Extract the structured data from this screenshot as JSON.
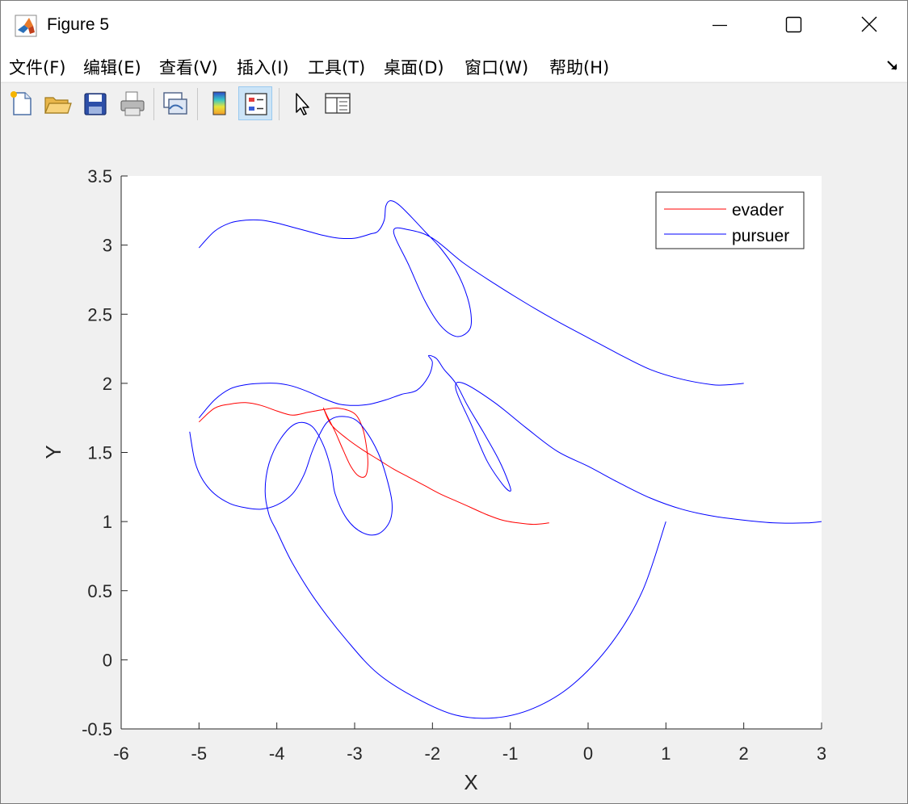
{
  "window": {
    "title": "Figure 5",
    "controls": {
      "minimize": "minimize",
      "maximize": "maximize",
      "close": "close"
    }
  },
  "menu": [
    {
      "label": "文件(F)"
    },
    {
      "label": "编辑(E)"
    },
    {
      "label": "查看(V)"
    },
    {
      "label": "插入(I)"
    },
    {
      "label": "工具(T)"
    },
    {
      "label": "桌面(D)"
    },
    {
      "label": "窗口(W)"
    },
    {
      "label": "帮助(H)"
    }
  ],
  "toolbar": [
    {
      "icon": "new-figure-icon"
    },
    {
      "icon": "open-file-icon"
    },
    {
      "icon": "save-icon"
    },
    {
      "icon": "print-icon"
    },
    {
      "icon": "link-plot-icon"
    },
    {
      "icon": "colorbar-icon"
    },
    {
      "icon": "legend-icon",
      "active": true
    },
    {
      "icon": "edit-plot-pointer-icon"
    },
    {
      "icon": "property-inspector-icon"
    }
  ],
  "chart_data": {
    "type": "line",
    "xlabel": "X",
    "ylabel": "Y",
    "xlim": [
      -6,
      3
    ],
    "ylim": [
      -0.5,
      3.5
    ],
    "xticks": [
      -6,
      -5,
      -4,
      -3,
      -2,
      -1,
      0,
      1,
      2,
      3
    ],
    "yticks": [
      -0.5,
      0,
      0.5,
      1,
      1.5,
      2,
      2.5,
      3,
      3.5
    ],
    "xtick_labels": [
      "-6",
      "-5",
      "-4",
      "-3",
      "-2",
      "-1",
      "0",
      "1",
      "2",
      "3"
    ],
    "ytick_labels": [
      "-0.5",
      "0",
      "0.5",
      "1",
      "1.5",
      "2",
      "2.5",
      "3",
      "3.5"
    ],
    "grid": false,
    "legend": {
      "position": "top-right",
      "entries": [
        "evader",
        "pursuer"
      ]
    },
    "colors": {
      "evader": "#ff0000",
      "pursuer": "#0000ff"
    },
    "series": [
      {
        "name": "evader",
        "color": "#ff0000",
        "x": [
          -5.0,
          -4.8,
          -4.6,
          -4.4,
          -4.2,
          -4.0,
          -3.8,
          -3.6,
          -3.4,
          -3.2,
          -3.0,
          -2.9,
          -2.85,
          -2.83,
          -2.86,
          -2.95,
          -3.05,
          -3.15,
          -3.25,
          -3.35,
          -3.4,
          -3.3,
          -3.1,
          -2.9,
          -2.7,
          -2.5,
          -2.3,
          -2.1,
          -1.9,
          -1.7,
          -1.5,
          -1.3,
          -1.1,
          -0.9,
          -0.7,
          -0.5
        ],
        "y": [
          1.72,
          1.82,
          1.85,
          1.86,
          1.84,
          1.8,
          1.77,
          1.79,
          1.81,
          1.82,
          1.78,
          1.68,
          1.55,
          1.42,
          1.33,
          1.33,
          1.4,
          1.52,
          1.65,
          1.76,
          1.82,
          1.7,
          1.6,
          1.52,
          1.45,
          1.38,
          1.32,
          1.26,
          1.2,
          1.15,
          1.1,
          1.05,
          1.01,
          0.99,
          0.98,
          0.99
        ]
      },
      {
        "name": "pursuer",
        "color": "#0000ff",
        "x": [
          -5.0,
          -4.8,
          -4.6,
          -4.4,
          -4.2,
          -4.0,
          -3.8,
          -3.6,
          -3.4,
          -3.2,
          -3.0,
          -2.8,
          -2.7,
          -2.62,
          -2.6,
          -2.55,
          -2.45,
          -2.3,
          -2.1,
          -1.9,
          -1.7,
          -1.55,
          -1.5,
          -1.55,
          -1.7,
          -1.9,
          -2.1,
          -2.3,
          -2.5,
          -2.3,
          -2.0,
          -1.6,
          -1.2,
          -0.8,
          -0.4,
          0.0,
          0.4,
          0.8,
          1.2,
          1.6,
          1.8,
          2.0
        ],
        "y": [
          2.98,
          3.1,
          3.16,
          3.18,
          3.18,
          3.16,
          3.13,
          3.1,
          3.07,
          3.05,
          3.05,
          3.08,
          3.1,
          3.18,
          3.28,
          3.32,
          3.3,
          3.22,
          3.1,
          2.98,
          2.82,
          2.62,
          2.45,
          2.37,
          2.34,
          2.42,
          2.6,
          2.85,
          3.1,
          3.11,
          3.05,
          2.87,
          2.72,
          2.58,
          2.45,
          2.33,
          2.21,
          2.1,
          2.03,
          1.99,
          1.99,
          2.0
        ]
      },
      {
        "name": "",
        "color": "#0000ff",
        "x": [
          -5.0,
          -4.8,
          -4.6,
          -4.4,
          -4.2,
          -4.0,
          -3.8,
          -3.6,
          -3.4,
          -3.2,
          -3.0,
          -2.8,
          -2.6,
          -2.4,
          -2.2,
          -2.05,
          -2.0,
          -2.05,
          -1.95,
          -1.85,
          -1.7,
          -1.55,
          -1.35,
          -1.15,
          -1.02,
          -1.0,
          -1.1,
          -1.3,
          -1.5,
          -1.7,
          -1.6,
          -1.2,
          -0.8,
          -0.4,
          0.0,
          0.4,
          0.8,
          1.2,
          1.6,
          2.0,
          2.4,
          2.8,
          3.0
        ],
        "y": [
          1.75,
          1.88,
          1.96,
          1.99,
          2.0,
          2.0,
          1.98,
          1.94,
          1.89,
          1.85,
          1.84,
          1.85,
          1.88,
          1.92,
          1.95,
          2.05,
          2.15,
          2.2,
          2.18,
          2.1,
          2.0,
          1.84,
          1.65,
          1.45,
          1.28,
          1.22,
          1.27,
          1.44,
          1.7,
          1.96,
          2.0,
          1.86,
          1.68,
          1.51,
          1.4,
          1.28,
          1.17,
          1.09,
          1.04,
          1.01,
          0.99,
          0.99,
          1.0
        ]
      },
      {
        "name": "",
        "color": "#0000ff",
        "x": [
          -5.12,
          -5.05,
          -4.95,
          -4.8,
          -4.6,
          -4.4,
          -4.2,
          -4.0,
          -3.8,
          -3.65,
          -3.55,
          -3.45,
          -3.35,
          -3.2,
          -3.0,
          -2.85,
          -2.7,
          -2.6,
          -2.52,
          -2.55,
          -2.7,
          -2.9,
          -3.1,
          -3.25,
          -3.3,
          -3.4,
          -3.55,
          -3.75,
          -3.95,
          -4.1,
          -4.15,
          -4.1,
          -4.0,
          -3.8,
          -3.5,
          -3.1,
          -2.7,
          -2.2,
          -1.7,
          -1.2,
          -0.7,
          -0.2,
          0.3,
          0.7,
          1.0
        ],
        "y": [
          1.65,
          1.43,
          1.3,
          1.2,
          1.13,
          1.1,
          1.09,
          1.12,
          1.2,
          1.34,
          1.5,
          1.63,
          1.72,
          1.76,
          1.74,
          1.65,
          1.5,
          1.34,
          1.14,
          1.0,
          0.91,
          0.92,
          1.02,
          1.2,
          1.37,
          1.55,
          1.69,
          1.71,
          1.6,
          1.42,
          1.22,
          1.05,
          0.93,
          0.7,
          0.43,
          0.14,
          -0.1,
          -0.28,
          -0.4,
          -0.42,
          -0.35,
          -0.18,
          0.12,
          0.5,
          1.0
        ]
      }
    ]
  }
}
